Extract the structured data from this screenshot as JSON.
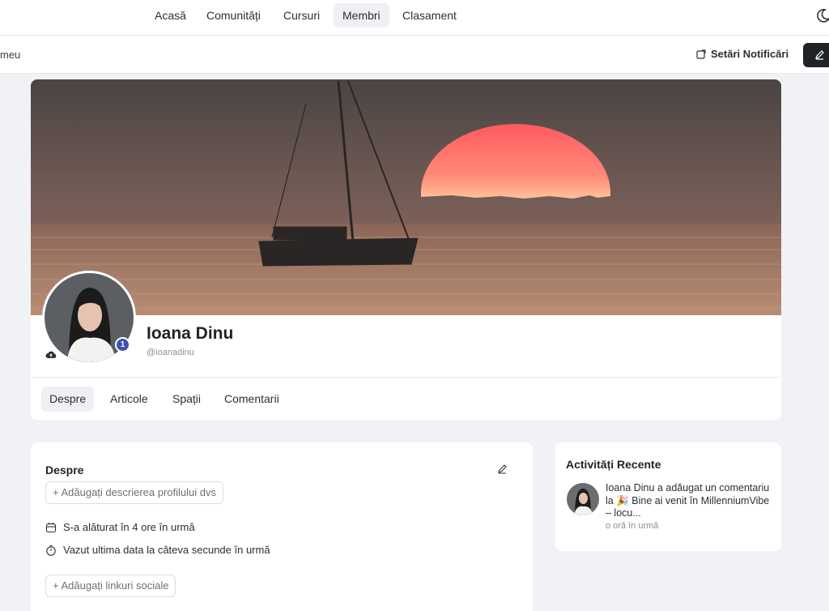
{
  "nav": {
    "items": [
      {
        "label": "Acasă",
        "active": false
      },
      {
        "label": "Comunități",
        "active": false
      },
      {
        "label": "Cursuri",
        "active": false
      },
      {
        "label": "Membri",
        "active": true
      },
      {
        "label": "Clasament",
        "active": false
      }
    ],
    "theme_icon": "moon-icon"
  },
  "subbar": {
    "left_text": "meu",
    "notifications_label": "Setări Notificări",
    "notifications_icon": "external-link-icon",
    "edit_icon": "pencil-icon"
  },
  "profile": {
    "name": "Ioana Dinu",
    "handle": "@ioanadinu",
    "badge": "1",
    "upload_icon": "cloud-upload-icon",
    "tabs": [
      {
        "label": "Despre",
        "active": true
      },
      {
        "label": "Articole",
        "active": false
      },
      {
        "label": "Spații",
        "active": false
      },
      {
        "label": "Comentarii",
        "active": false
      }
    ]
  },
  "about": {
    "title": "Despre",
    "add_description": "+ Adăugați descrierea profilului dvs",
    "joined": "S-a alăturat în 4 ore în urmă",
    "last_seen": "Vazut ultima data la câteva secunde în urmă",
    "add_social": "+ Adăugați linkuri sociale"
  },
  "activity": {
    "title": "Activități Recente",
    "item": {
      "actor": "Ioana Dinu",
      "action": " a adăugat un comentariu la ",
      "emoji": "🎉",
      "target": " Bine ai venit în MillenniumVibe – locu...",
      "time": "o oră în urmă"
    }
  },
  "colors": {
    "accent_dark": "#1f2328",
    "badge": "#3f51b5",
    "sun": "#ff6e6e"
  }
}
